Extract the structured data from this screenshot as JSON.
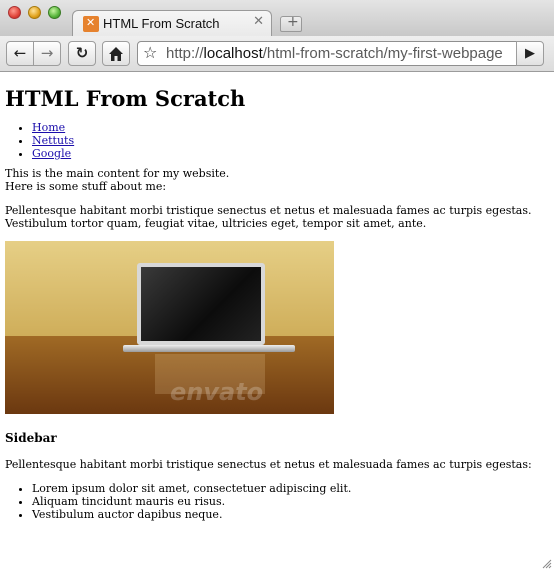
{
  "browser": {
    "tab_title": "HTML From Scratch",
    "url_prefix": "http://",
    "url_host": "localhost",
    "url_path": "/html-from-scratch/my-first-webpage"
  },
  "page": {
    "heading": "HTML From Scratch",
    "nav_links": [
      "Home",
      "Nettuts",
      "Google"
    ],
    "intro_line1": "This is the main content for my website.",
    "intro_line2": "Here is some stuff about me:",
    "paragraph": "Pellentesque habitant morbi tristique senectus et netus et malesuada fames ac turpis egestas. Vestibulum tortor quam, feugiat vitae, ultricies eget, tempor sit amet, ante.",
    "image_watermark": "envato",
    "sidebar_heading": "Sidebar",
    "sidebar_paragraph": "Pellentesque habitant morbi tristique senectus et netus et malesuada fames ac turpis egestas:",
    "sidebar_items": [
      "Lorem ipsum dolor sit amet, consectetuer adipiscing elit.",
      "Aliquam tincidunt mauris eu risus.",
      "Vestibulum auctor dapibus neque."
    ]
  }
}
